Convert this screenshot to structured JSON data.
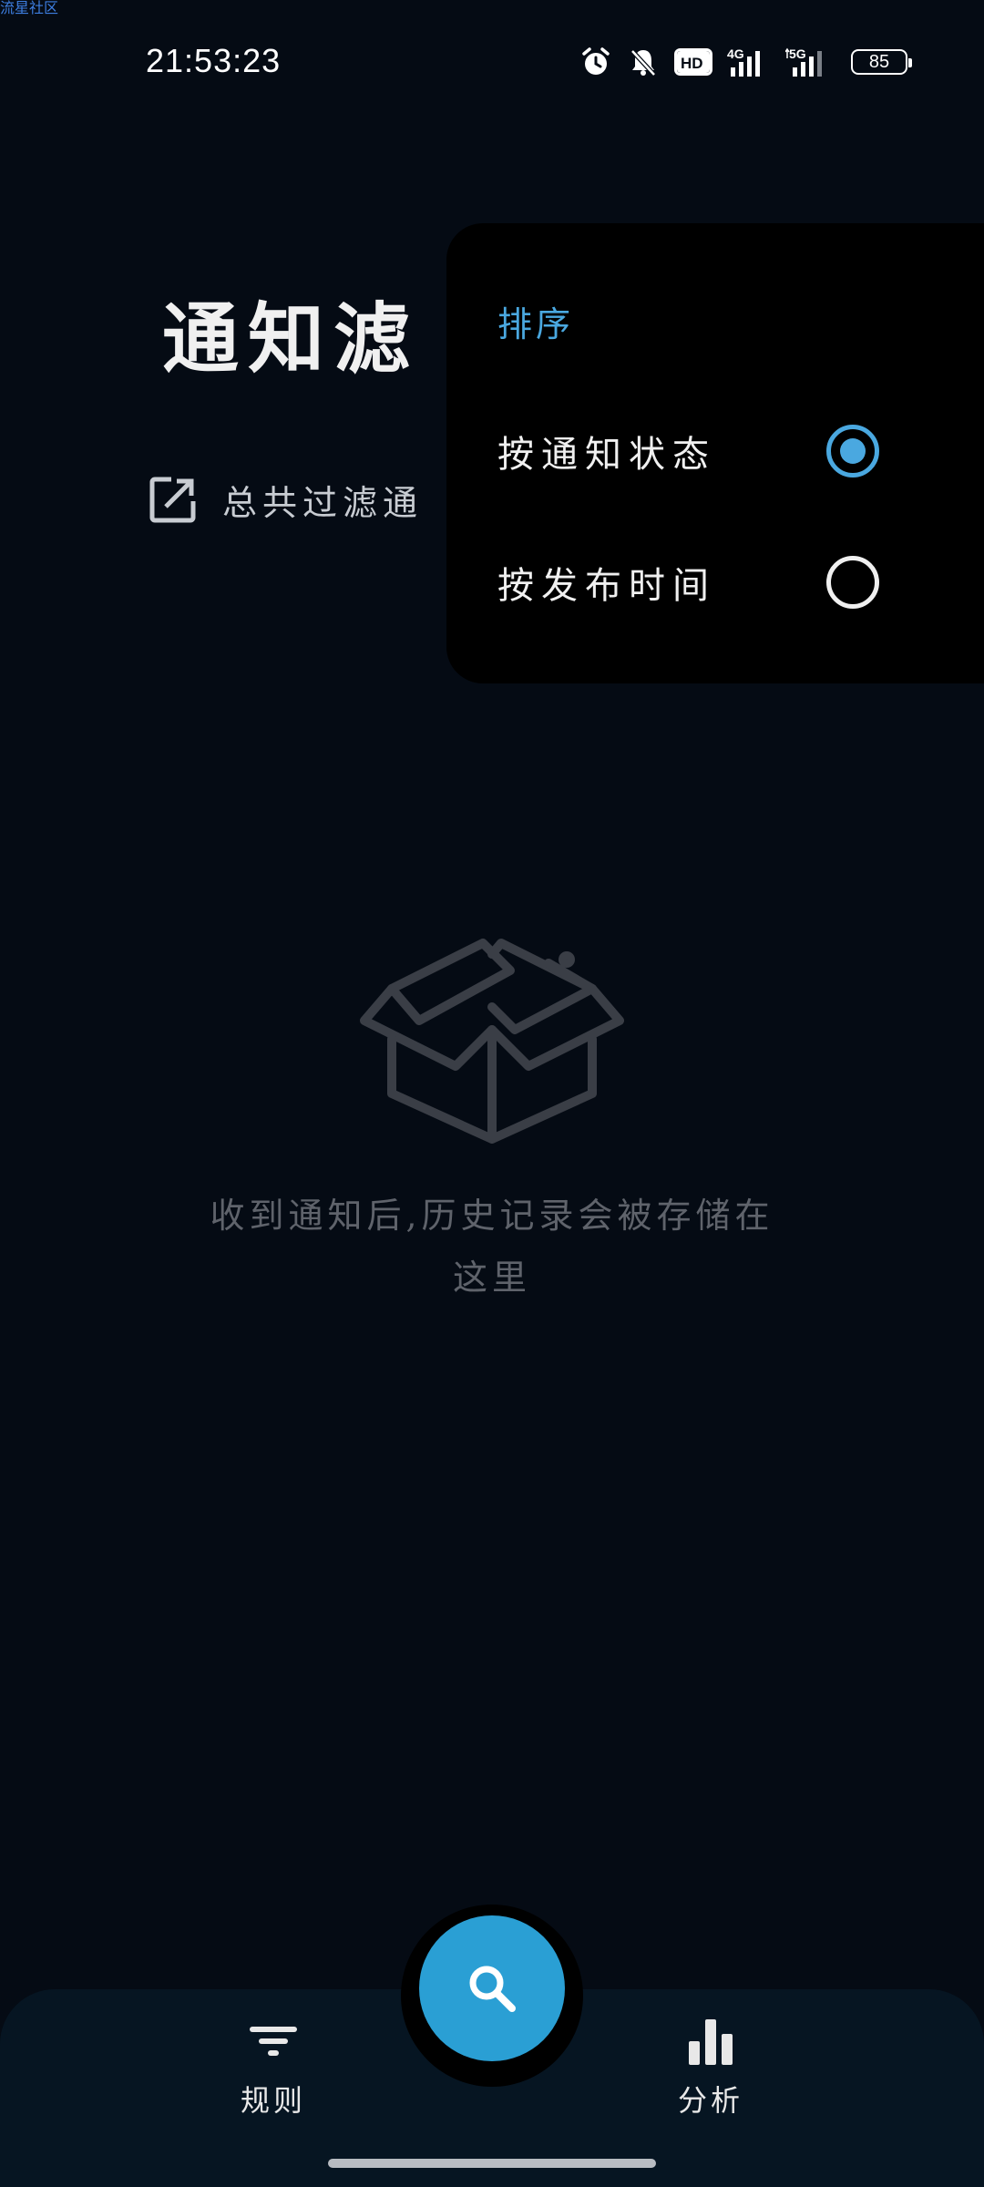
{
  "watermark": "流星社区",
  "status_bar": {
    "time": "21:53:23",
    "network_1": "4G",
    "network_2": "5G",
    "hd_badge": "HD",
    "battery": "85",
    "icons": [
      "alarm-icon",
      "bell-muted-icon",
      "hd-icon",
      "signal-4g-icon",
      "signal-5g-icon",
      "battery-icon"
    ]
  },
  "page": {
    "title": "通知滤",
    "filter_count_text": "总共过滤通",
    "empty_text_line1": "收到通知后,历史记录会被存储在",
    "empty_text_line2": "这里"
  },
  "sort_menu": {
    "title": "排序",
    "options": [
      {
        "label": "按通知状态",
        "selected": true
      },
      {
        "label": "按发布时间",
        "selected": false
      }
    ]
  },
  "bottom_nav": {
    "left": {
      "label": "规则",
      "icon": "filter-icon"
    },
    "right": {
      "label": "分析",
      "icon": "bar-chart-icon"
    },
    "fab": {
      "icon": "search-icon"
    }
  },
  "colors": {
    "background": "#050b14",
    "accent": "#2a9fd4",
    "popup_bg": "#000000",
    "bottom_bar": "#061522",
    "radio_selected": "#4aa8e0"
  }
}
